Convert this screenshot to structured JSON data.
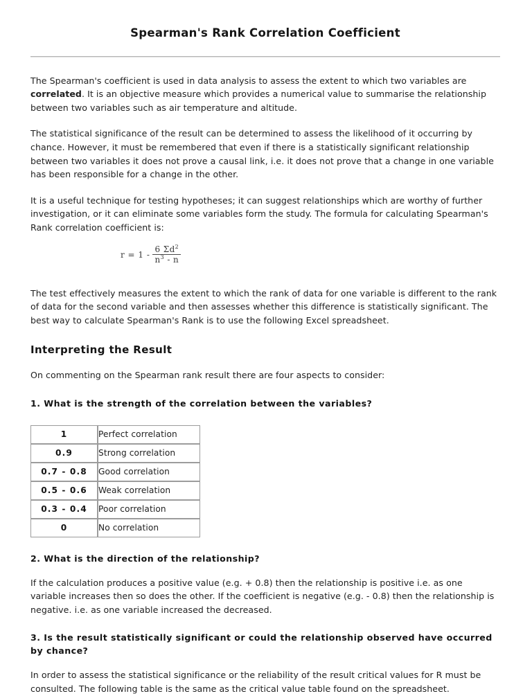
{
  "document": {
    "title": "Spearman's Rank Correlation Coefficient",
    "paragraphs": {
      "intro_pre": "The Spearman's coefficient is used in data analysis to assess the extent to which two variables are ",
      "intro_bold": "correlated",
      "intro_post": ". It is an objective measure which provides a numerical value to summarise the relationship between two variables such as air temperature and altitude.",
      "significance": "The statistical significance of the result can be determined to assess the likelihood of it occurring by chance. However, it must be remembered that even if there is a statistically significant relationship between two variables it does not prove a causal link, i.e. it does not prove that a change in one variable has been responsible for a change in the other.",
      "useful_technique": "It is a useful technique for testing hypotheses; it can suggest relationships which are worthy of further investigation, or it can eliminate some variables form the study. The formula for calculating Spearman's Rank correlation coefficient is:",
      "test_measures": "The test effectively measures the extent to which the rank of data for one variable is different to the rank of data for the second variable and then assesses whether this difference is statistically significant. The best way to calculate Spearman's Rank is to use the following Excel spreadsheet.",
      "commenting": "On commenting on the Spearman rank result there are four aspects to consider:",
      "direction_body": "If the calculation produces a positive value (e.g. + 0.8) then the relationship is positive i.e. as one variable increases then so does the other. If the coefficient is negative (e.g. - 0.8) then the relationship is negative. i.e. as one variable increased the decreased.",
      "significance_body": "In order to assess the statistical significance or the reliability of the result critical values for R must be consulted. The following table is the same as the critical value table found on the spreadsheet."
    },
    "formula": {
      "lead": "r = 1 -",
      "numerator_coefficient": "6",
      "numerator_symbol": "Σd",
      "numerator_exponent": "2",
      "denominator_base": "n",
      "denominator_exponent": "3",
      "denominator_tail": " - n",
      "plain": "r = 1 - 6Σd² / (n³ - n)"
    },
    "section_heading": "Interpreting the Result",
    "questions": {
      "q1": "1. What is the strength of the correlation between the variables?",
      "q2": "2. What is the direction of the relationship?",
      "q3": "3. Is the result statistically significant or could the relationship observed have occurred by chance?"
    },
    "strength_table": {
      "rows": [
        {
          "value": "1",
          "description": "Perfect correlation"
        },
        {
          "value": "0.9",
          "description": "Strong correlation"
        },
        {
          "value": "0.7 - 0.8",
          "description": "Good correlation"
        },
        {
          "value": "0.5 - 0.6",
          "description": "Weak correlation"
        },
        {
          "value": "0.3 - 0.4",
          "description": "Poor correlation"
        },
        {
          "value": "0",
          "description": "No correlation"
        }
      ]
    },
    "colors": {
      "text": "#1f1f1f",
      "heading": "#141414",
      "rule": "#b4b4b4",
      "table_border": "#9c9c9c",
      "page_background": "#ffffff"
    }
  }
}
